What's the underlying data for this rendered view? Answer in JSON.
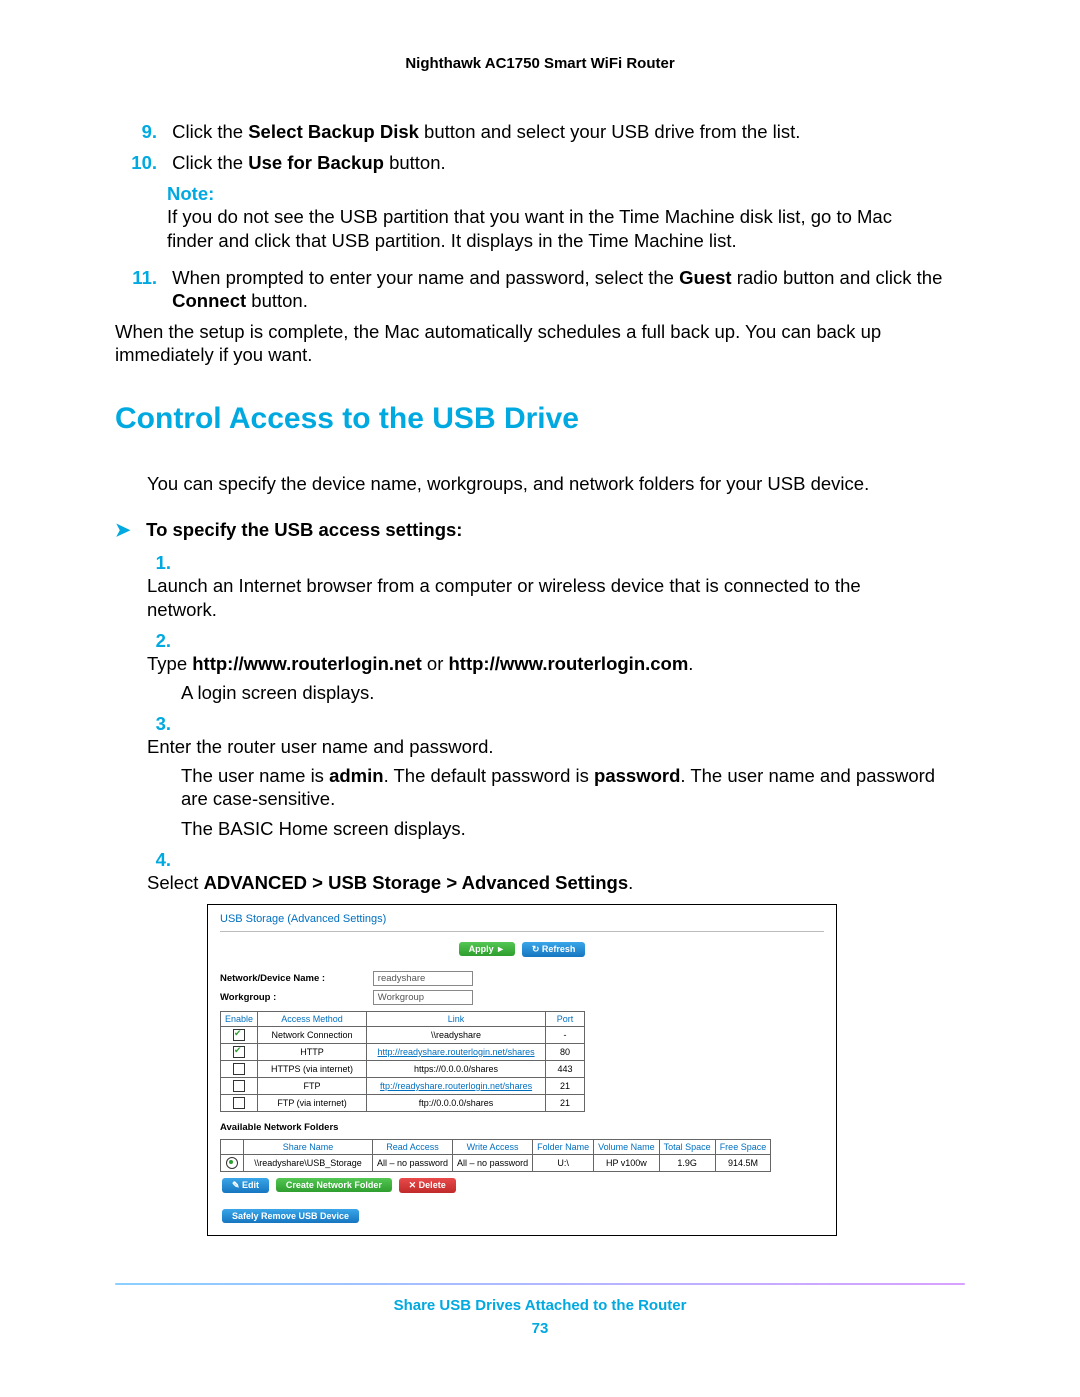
{
  "header": {
    "title": "Nighthawk AC1750 Smart WiFi Router"
  },
  "steps": {
    "s9": {
      "num": "9.",
      "text_pre": "Click the ",
      "bold1": "Select Backup Disk",
      "text_post": " button and select your USB drive from the list."
    },
    "s10": {
      "num": "10.",
      "text_pre": "Click the ",
      "bold1": "Use for Backup",
      "text_post": " button."
    },
    "note": {
      "label": "Note:",
      "text": "If you do not see the USB partition that you want in the Time Machine disk list, go to Mac finder and click that USB partition. It displays in the Time Machine list."
    },
    "s11": {
      "num": "11.",
      "text_pre": "When prompted to enter your name and password, select the ",
      "bold1": "Guest",
      "mid": " radio button and click the ",
      "bold2": "Connect",
      "post": " button."
    },
    "afterSetup": "When the setup is complete, the Mac automatically schedules a full back up. You can back up immediately if you want."
  },
  "section": {
    "title": "Control Access to the USB Drive"
  },
  "intro": "You can specify the device name, workgroups, and network folders for your USB device.",
  "procHeading": {
    "arrow": "➤",
    "text": "To specify the USB access settings:"
  },
  "proc": [
    {
      "num": "1.",
      "body": "Launch an Internet browser from a computer or wireless device that is connected to the network."
    },
    {
      "num": "2.",
      "body_pre": "Type ",
      "bold1": "http://www.routerlogin.net",
      "mid": " or ",
      "bold2": "http://www.routerlogin.com",
      "post": ".",
      "follow": "A login screen displays."
    },
    {
      "num": "3.",
      "body": "Enter the router user name and password.",
      "follows": [
        {
          "pre": "The user name is ",
          "b1": "admin",
          "mid": ". The default password is ",
          "b2": "password",
          "post": ". The user name and password are case-sensitive."
        },
        {
          "plain": "The BASIC Home screen displays."
        }
      ]
    },
    {
      "num": "4.",
      "body_pre": "Select ",
      "bold1": "ADVANCED > USB Storage > Advanced Settings",
      "post": "."
    }
  ],
  "ui": {
    "title": "USB Storage (Advanced Settings)",
    "apply": "Apply ►",
    "refresh": "↻ Refresh",
    "fields": {
      "deviceLabel": "Network/Device Name :",
      "deviceValue": "readyshare",
      "workgroupLabel": "Workgroup :",
      "workgroupValue": "Workgroup"
    },
    "accessTable": {
      "headers": [
        "Enable",
        "Access Method",
        "Link",
        "Port"
      ],
      "rows": [
        {
          "enabled": true,
          "method": "Network Connection",
          "link": "\\\\readyshare",
          "isLink": false,
          "port": "-"
        },
        {
          "enabled": true,
          "method": "HTTP",
          "link": "http://readyshare.routerlogin.net/shares",
          "isLink": true,
          "port": "80"
        },
        {
          "enabled": false,
          "method": "HTTPS (via internet)",
          "link": "https://0.0.0.0/shares",
          "isLink": false,
          "port": "443"
        },
        {
          "enabled": false,
          "method": "FTP",
          "link": "ftp://readyshare.routerlogin.net/shares",
          "isLink": true,
          "port": "21"
        },
        {
          "enabled": false,
          "method": "FTP (via internet)",
          "link": "ftp://0.0.0.0/shares",
          "isLink": false,
          "port": "21"
        }
      ]
    },
    "foldersTitle": "Available Network Folders",
    "foldersTable": {
      "headers": [
        "",
        "Share Name",
        "Read Access",
        "Write Access",
        "Folder Name",
        "Volume Name",
        "Total Space",
        "Free Space"
      ],
      "row": {
        "share": "\\\\readyshare\\USB_Storage",
        "read": "All – no password",
        "write": "All – no password",
        "folder": "U:\\",
        "volume": "HP v100w",
        "total": "1.9G",
        "free": "914.5M"
      }
    },
    "btns": {
      "edit": "✎ Edit",
      "create": "Create Network Folder",
      "delete": "✕ Delete",
      "safeRemove": "Safely Remove USB Device"
    }
  },
  "footer": {
    "text": "Share USB Drives Attached to the Router",
    "page": "73"
  }
}
